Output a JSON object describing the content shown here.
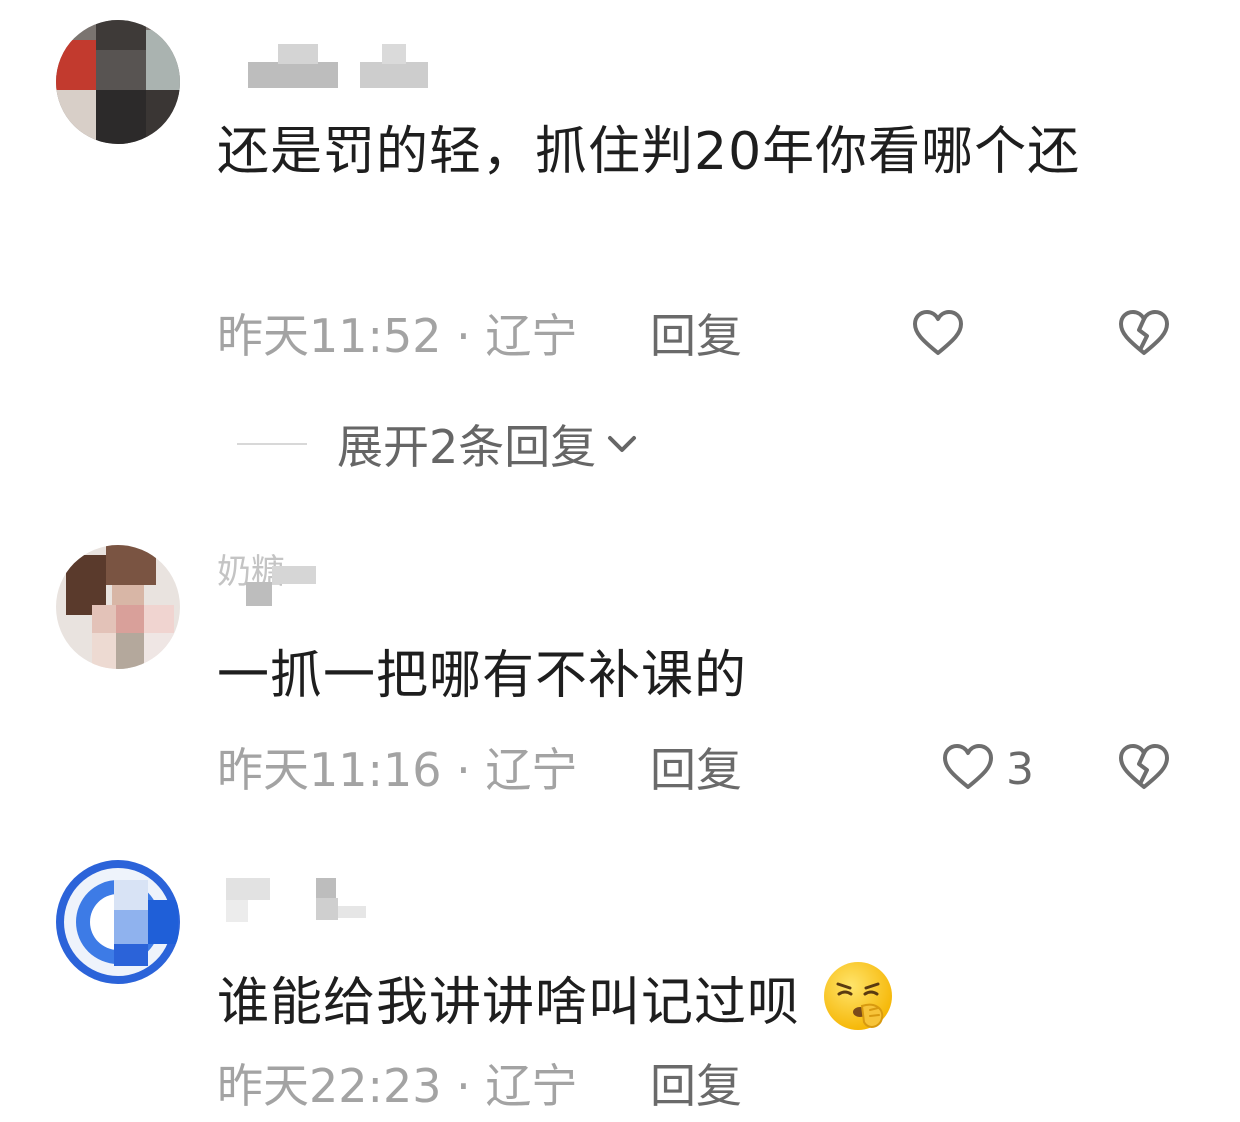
{
  "comments": [
    {
      "username": "",
      "text": "还是罚的轻，抓住判20年你看哪个还",
      "time": "昨天11:52 · 辽宁",
      "reply_label": "回复",
      "likes": ""
    },
    {
      "username": "奶糖",
      "text": "一抓一把哪有不补课的",
      "time": "昨天11:16 · 辽宁",
      "reply_label": "回复",
      "likes": "3"
    },
    {
      "username": "",
      "text": "谁能给我讲讲啥叫记过呗",
      "time": "昨天22:23 · 辽宁",
      "reply_label": "回复",
      "likes": ""
    }
  ],
  "expand_replies": {
    "label": "展开2条回复"
  },
  "icons": {
    "like": "heart-outline-icon",
    "dislike": "broken-heart-icon",
    "expand": "chevron-down-icon",
    "emoji": "shushing-face-emoji-icon"
  },
  "colors": {
    "text_primary": "#1e1e1e",
    "text_meta": "#a3a3a3",
    "text_action": "#6a6a6a",
    "icon_stroke": "#6e6e6e"
  }
}
